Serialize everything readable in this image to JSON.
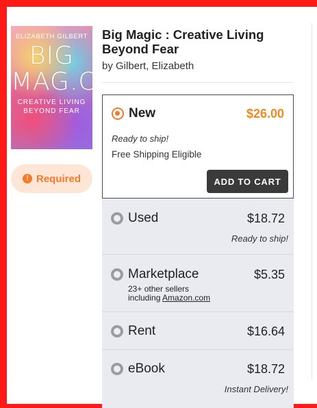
{
  "book": {
    "title": "Big Magic : Creative Living Beyond Fear",
    "byline": "by Gilbert, Elizabeth",
    "cover": {
      "author": "ELIZABETH GILBERT",
      "title_line1": "BIG",
      "title_line2": "MAG.C",
      "tagline_line1": "CREATIVE LIVING",
      "tagline_line2": "BEYOND FEAR"
    }
  },
  "required": {
    "label": "Required",
    "icon": "alert-badge-icon",
    "color": "#f47a2a"
  },
  "options": {
    "new": {
      "label": "New",
      "price": "$26.00",
      "ship_note": "Ready to ship!",
      "shipping": "Free Shipping Eligible",
      "cart_label": "ADD TO CART",
      "selected": true
    },
    "used": {
      "label": "Used",
      "price": "$18.72",
      "note": "Ready to ship!"
    },
    "marketplace": {
      "label": "Marketplace",
      "price": "$5.35",
      "sellers_line1": "23+ other sellers",
      "sellers_prefix": "including ",
      "sellers_link": "Amazon.com"
    },
    "rent": {
      "label": "Rent",
      "price": "$16.64"
    },
    "ebook": {
      "label": "eBook",
      "price": "$18.72",
      "note": "Instant Delivery!"
    }
  },
  "colors": {
    "accent": "#f47a2a",
    "price_accent": "#f08a1c",
    "frame": "#ff1a1a",
    "option_bg": "#e9ebf0",
    "button_bg": "#3a3a3a"
  }
}
